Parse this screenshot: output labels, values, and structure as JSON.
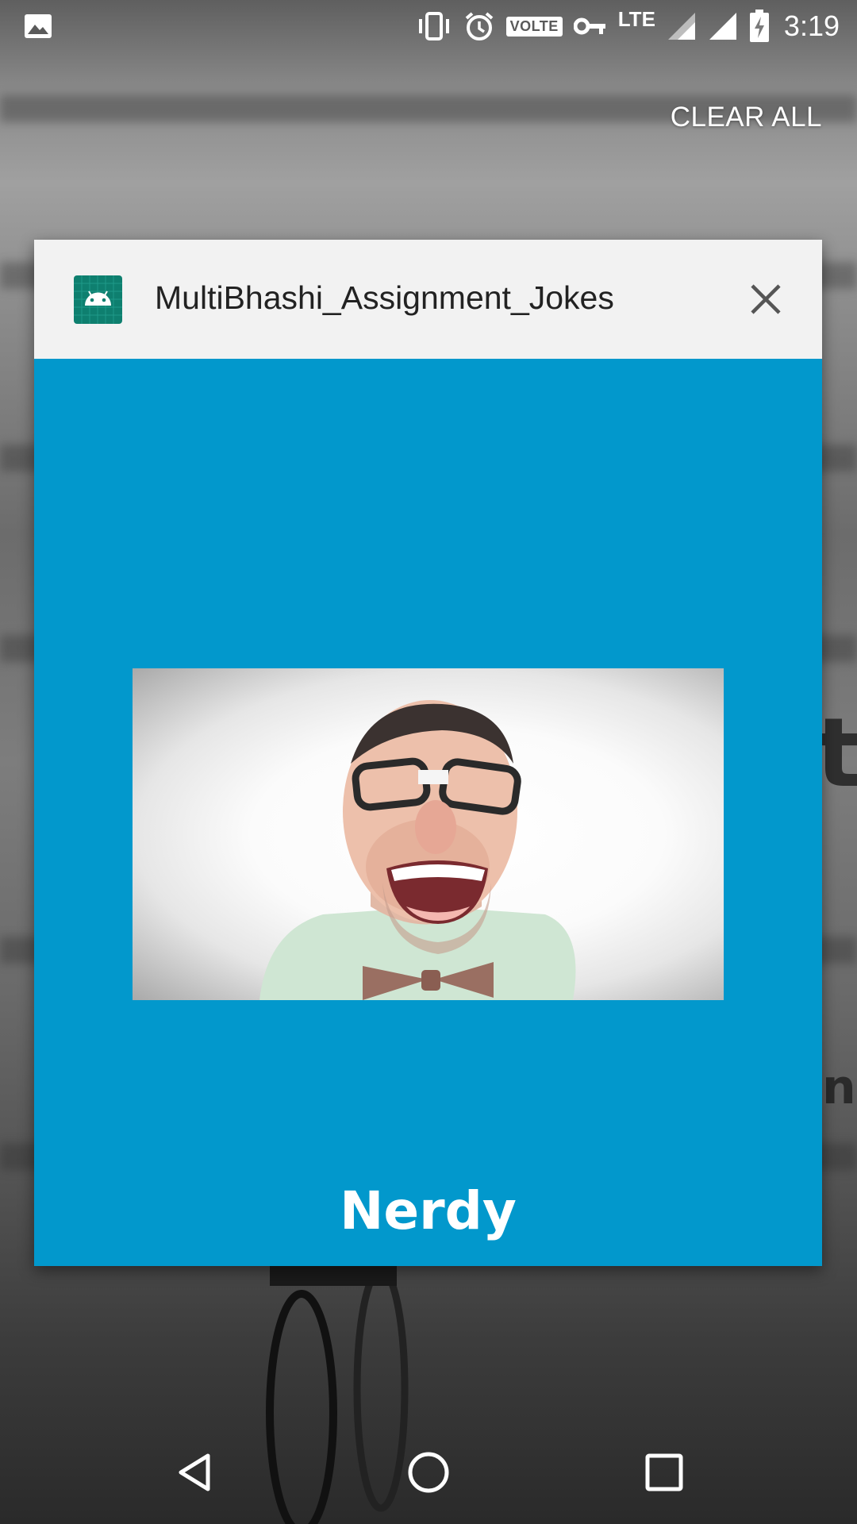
{
  "status_bar": {
    "time": "3:19",
    "network_type": "LTE",
    "volte_label": "VOLTE",
    "icons": [
      "image-notification-icon",
      "vibrate-icon",
      "alarm-icon",
      "volte-icon",
      "vpn-key-icon",
      "signal-icon",
      "signal-icon",
      "battery-charging-icon"
    ]
  },
  "recents": {
    "clear_all_label": "CLEAR ALL"
  },
  "task_card": {
    "app_title": "MultiBhashi_Assignment_Jokes",
    "app_icon": "android-app-icon",
    "close_icon": "close-icon",
    "body_color": "#0298cc",
    "category_label": "Nerdy"
  },
  "nav_bar": {
    "buttons": [
      "back-icon",
      "home-icon",
      "recents-icon"
    ]
  },
  "colors": {
    "card_body": "#0298cc",
    "card_header": "#f2f2f2",
    "app_icon_bg": "#0e7f6f"
  }
}
